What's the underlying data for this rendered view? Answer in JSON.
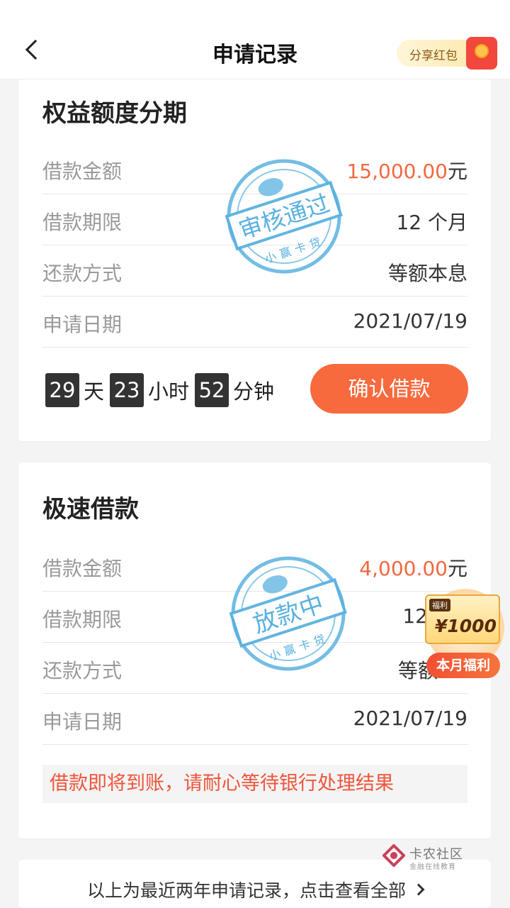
{
  "header": {
    "title": "申请记录",
    "share_label": "分享红包"
  },
  "cards": [
    {
      "title": "权益额度分期",
      "stamp": {
        "text": "审核通过",
        "brand": "小赢卡贷",
        "color": "#5ab1e0"
      },
      "rows": [
        {
          "label": "借款金额",
          "value": "15,000.00",
          "unit": "元"
        },
        {
          "label": "借款期限",
          "value": "12 个月"
        },
        {
          "label": "还款方式",
          "value": "等额本息"
        },
        {
          "label": "申请日期",
          "value": "2021/07/19"
        }
      ],
      "countdown": {
        "days": "29",
        "days_unit": "天",
        "hours": "23",
        "hours_unit": "小时",
        "minutes": "52",
        "minutes_unit": "分钟"
      },
      "button": "确认借款"
    },
    {
      "title": "极速借款",
      "stamp": {
        "text": "放款中",
        "brand": "小赢卡贷",
        "color": "#5ab1e0"
      },
      "rows": [
        {
          "label": "借款金额",
          "value": "4,000.00",
          "unit": "元"
        },
        {
          "label": "借款期限",
          "value": "12"
        },
        {
          "label": "还款方式",
          "value": "等额"
        },
        {
          "label": "申请日期",
          "value": "2021/07/19"
        }
      ],
      "notice": "借款即将到账，请耐心等待银行处理结果"
    }
  ],
  "promo": {
    "tag": "福利",
    "amount": "¥1000",
    "label": "本月福利"
  },
  "watermark": {
    "title": "卡农社区",
    "subtitle": "金融在线教育"
  },
  "footer": {
    "link_text": "以上为最近两年申请记录，点击查看全部"
  },
  "colors": {
    "accent": "#f76a3d",
    "amount": "#f3683f",
    "stamp": "#5ab1e0"
  },
  "icons": {
    "back": "chevron-left-icon",
    "footer": "chevron-right-icon"
  }
}
